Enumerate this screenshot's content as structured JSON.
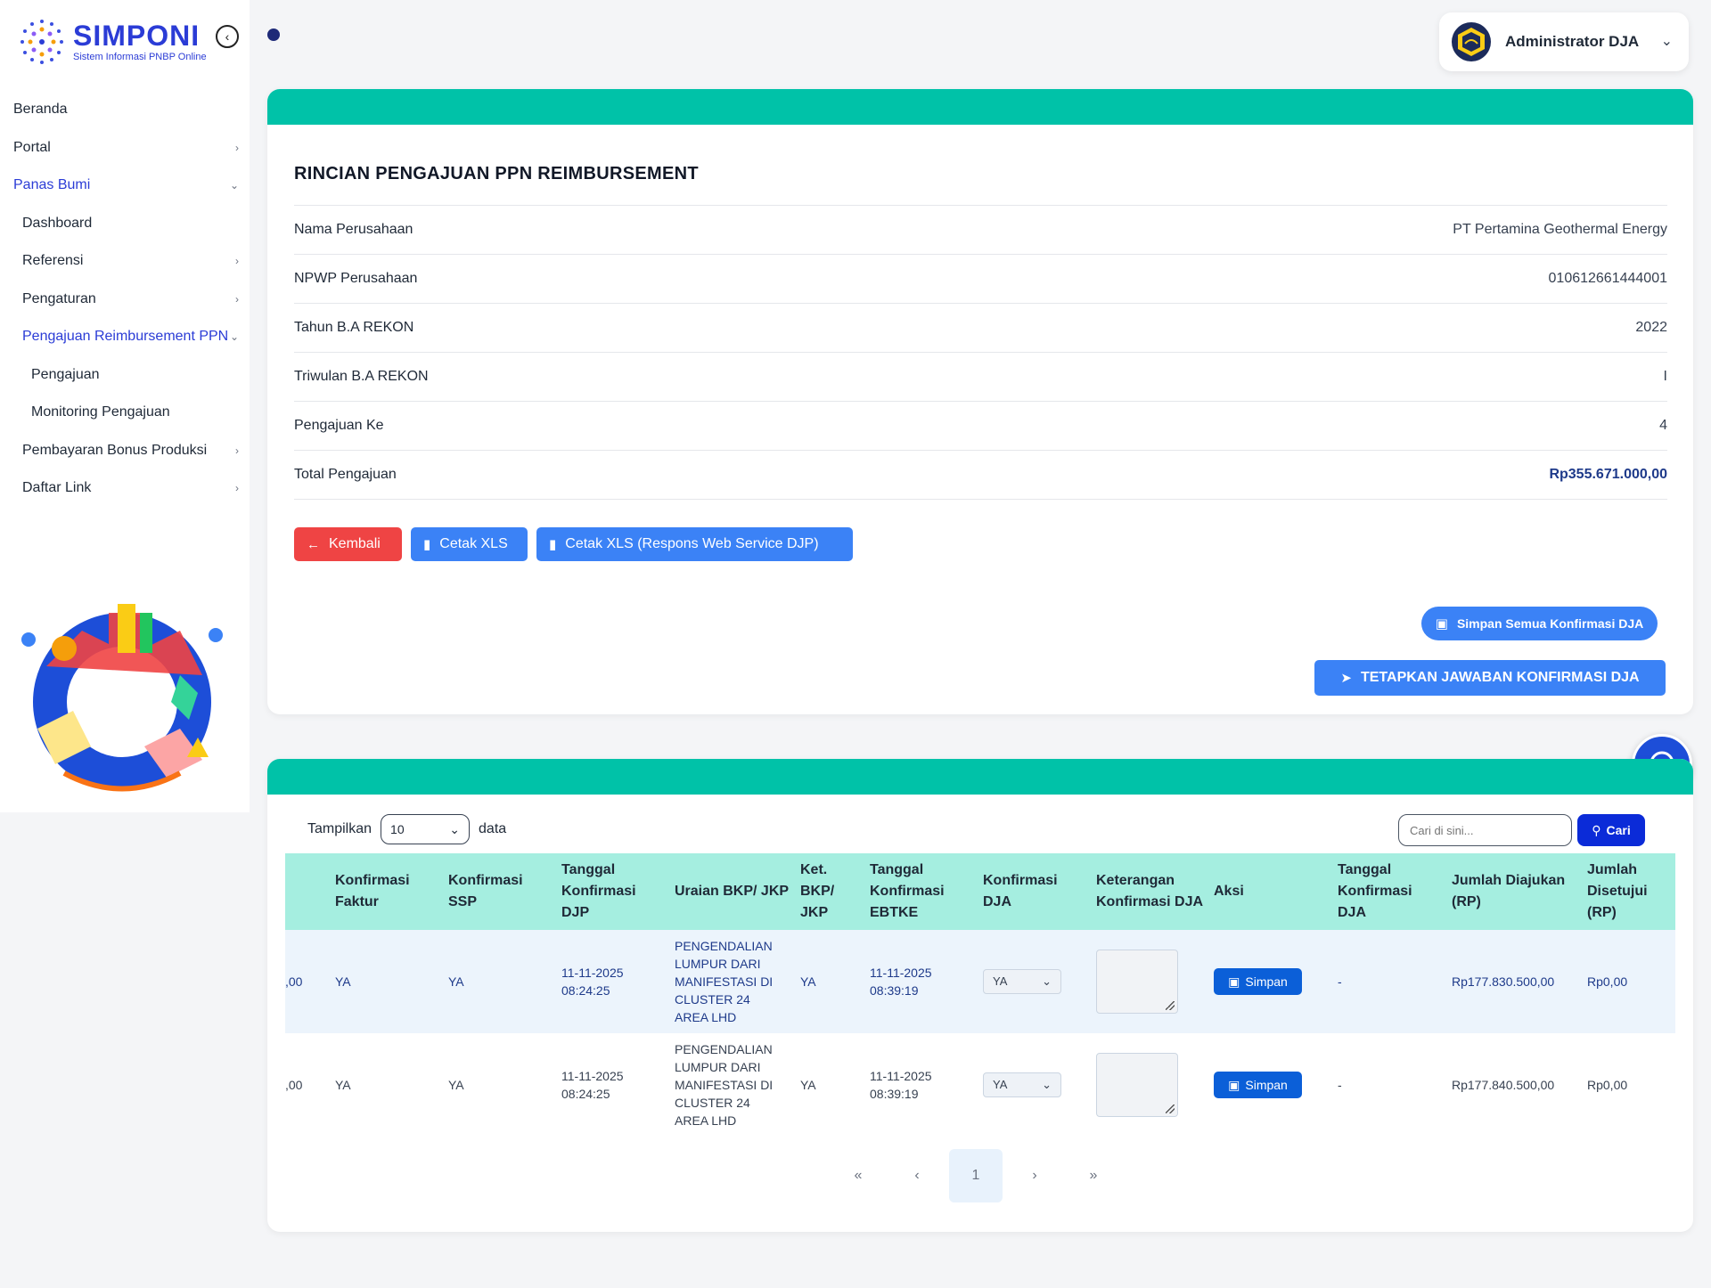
{
  "app": {
    "logo_title": "SIMPONI",
    "logo_subtitle": "Sistem Informasi PNBP Online"
  },
  "sidebar": {
    "items": [
      {
        "label": "Beranda",
        "level": 0,
        "chevron": ""
      },
      {
        "label": "Portal",
        "level": 0,
        "chevron": "›"
      },
      {
        "label": "Panas Bumi",
        "level": 0,
        "chevron": "⌄",
        "active": true
      },
      {
        "label": "Dashboard",
        "level": 1,
        "chevron": ""
      },
      {
        "label": "Referensi",
        "level": 1,
        "chevron": "›"
      },
      {
        "label": "Pengaturan",
        "level": 1,
        "chevron": "›"
      },
      {
        "label": "Pengajuan Reimbursement PPN",
        "level": 1,
        "chevron": "⌄",
        "active": true
      },
      {
        "label": "Pengajuan",
        "level": 2,
        "chevron": ""
      },
      {
        "label": "Monitoring Pengajuan",
        "level": 2,
        "chevron": ""
      },
      {
        "label": "Pembayaran Bonus Produksi",
        "level": 1,
        "chevron": "›"
      },
      {
        "label": "Daftar Link",
        "level": 1,
        "chevron": "›"
      }
    ]
  },
  "user": {
    "name": "Administrator DJA"
  },
  "detail": {
    "title": "RINCIAN PENGAJUAN PPN REIMBURSEMENT",
    "rows": [
      {
        "label": "Nama Perusahaan",
        "value": "PT Pertamina Geothermal Energy"
      },
      {
        "label": "NPWP Perusahaan",
        "value": "010612661444001"
      },
      {
        "label": "Tahun B.A REKON",
        "value": "2022"
      },
      {
        "label": "Triwulan B.A REKON",
        "value": "I"
      },
      {
        "label": "Pengajuan Ke",
        "value": "4"
      },
      {
        "label": "Total Pengajuan",
        "value": "Rp355.671.000,00"
      }
    ],
    "buttons": {
      "kembali": "Kembali",
      "cetak_xls": "Cetak XLS",
      "cetak_xls_djp": "Cetak XLS (Respons Web Service DJP)",
      "simpan_semua": "Simpan Semua Konfirmasi DJA",
      "tetapkan": "TETAPKAN JAWABAN KONFIRMASI DJA"
    }
  },
  "table": {
    "show_label": "Tampilkan",
    "page_length": "10",
    "data_label": "data",
    "search_placeholder": "Cari di sini...",
    "search_button": "Cari",
    "columns": [
      {
        "label": ""
      },
      {
        "label": "Konfirmasi Faktur"
      },
      {
        "label": "Konfirmasi SSP"
      },
      {
        "label": "Tanggal Konfirmasi DJP"
      },
      {
        "label": "Uraian BKP/ JKP"
      },
      {
        "label": "Ket. BKP/ JKP"
      },
      {
        "label": "Tanggal Konfirmasi EBTKE"
      },
      {
        "label": "Konfirmasi DJA"
      },
      {
        "label": "Keterangan Konfirmasi DJA"
      },
      {
        "label": "Aksi"
      },
      {
        "label": "Tanggal Konfirmasi DJA"
      },
      {
        "label": "Jumlah Diajukan (RP)"
      },
      {
        "label": "Jumlah Disetujui (RP)"
      }
    ],
    "rows": [
      {
        "cut": ",00",
        "konf_faktur": "YA",
        "konf_ssp": "YA",
        "tgl_djp": "11-11-2025\n08:24:25",
        "uraian": "PENGENDALIAN\nLUMPUR DARI\nMANIFESTASI DI\nCLUSTER 24\nAREA LHD",
        "ket": "YA",
        "tgl_ebtke": "11-11-2025\n08:39:19",
        "konf_dja": "YA",
        "aksi": "Simpan",
        "tgl_dja": "-",
        "diajukan": "Rp177.830.500,00",
        "disetujui": "Rp0,00"
      },
      {
        "cut": ",00",
        "konf_faktur": "YA",
        "konf_ssp": "YA",
        "tgl_djp": "11-11-2025\n08:24:25",
        "uraian": "PENGENDALIAN\nLUMPUR DARI\nMANIFESTASI DI\nCLUSTER 24\nAREA LHD",
        "ket": "YA",
        "tgl_ebtke": "11-11-2025\n08:39:19",
        "konf_dja": "YA",
        "aksi": "Simpan",
        "tgl_dja": "-",
        "diajukan": "Rp177.840.500,00",
        "disetujui": "Rp0,00"
      }
    ],
    "pager": {
      "first": "«",
      "prev": "‹",
      "current": "1",
      "next": "›",
      "last": "»"
    }
  },
  "colors": {
    "accent_teal": "#00c2a8",
    "header_teal": "#a5eee0",
    "primary_blue": "#3b82f6",
    "danger_red": "#ef4444",
    "brand_blue": "#2b3cd6"
  }
}
